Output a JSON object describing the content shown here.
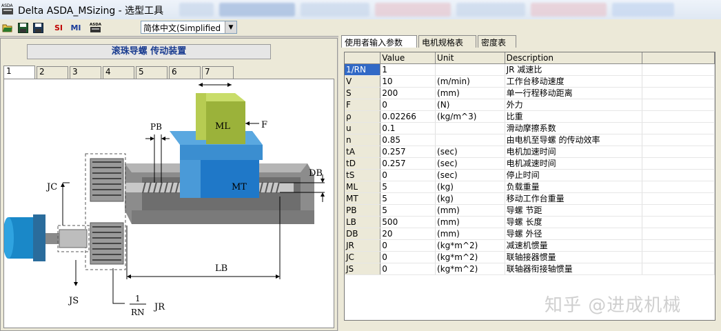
{
  "window": {
    "title": "Delta ASDA_MSizing - 选型工具"
  },
  "toolbar": {
    "si_label": "SI",
    "mi_label": "MI",
    "language_value": "简体中文(Simplified"
  },
  "left": {
    "header": "滚珠导螺 传动装置",
    "tabs": [
      "1",
      "2",
      "3",
      "4",
      "5",
      "6",
      "7"
    ],
    "diagram_labels": {
      "ml": "ML",
      "mt": "MT",
      "f": "F",
      "pb": "PB",
      "db": "DB",
      "jc": "JC",
      "js": "JS",
      "lb": "LB",
      "one": "1",
      "rn": "RN",
      "jr": "JR"
    }
  },
  "right": {
    "tabs": [
      "使用者输入参数",
      "电机规格表",
      "密度表"
    ],
    "columns": [
      "",
      "Value",
      "Unit",
      "Description",
      ""
    ],
    "rows": [
      {
        "name": "1/RN",
        "value": "1",
        "unit": "",
        "desc": "JR 减速比"
      },
      {
        "name": "V",
        "value": "10",
        "unit": "(m/min)",
        "desc": "工作台移动速度"
      },
      {
        "name": "S",
        "value": "200",
        "unit": "(mm)",
        "desc": "单一行程移动距离"
      },
      {
        "name": "F",
        "value": "0",
        "unit": "(N)",
        "desc": "外力"
      },
      {
        "name": "ρ",
        "value": "0.02266",
        "unit": "(kg/m^3)",
        "desc": "比重"
      },
      {
        "name": "u",
        "value": "0.1",
        "unit": "",
        "desc": "滑动摩擦系数"
      },
      {
        "name": "n",
        "value": "0.85",
        "unit": "",
        "desc": "由电机至导螺 的传动效率"
      },
      {
        "name": "tA",
        "value": "0.257",
        "unit": "(sec)",
        "desc": "电机加速时间"
      },
      {
        "name": "tD",
        "value": "0.257",
        "unit": "(sec)",
        "desc": "电机减速时间"
      },
      {
        "name": "tS",
        "value": "0",
        "unit": "(sec)",
        "desc": "停止时间"
      },
      {
        "name": "ML",
        "value": "5",
        "unit": "(kg)",
        "desc": "负载重量"
      },
      {
        "name": "MT",
        "value": "5",
        "unit": "(kg)",
        "desc": "移动工作台重量"
      },
      {
        "name": "PB",
        "value": "5",
        "unit": "(mm)",
        "desc": "导螺 节距"
      },
      {
        "name": "LB",
        "value": "500",
        "unit": "(mm)",
        "desc": "导螺 长度"
      },
      {
        "name": "DB",
        "value": "20",
        "unit": "(mm)",
        "desc": "导螺 外径"
      },
      {
        "name": "JR",
        "value": "0",
        "unit": "(kg*m^2)",
        "desc": "减速机惯量"
      },
      {
        "name": "JC",
        "value": "0",
        "unit": "(kg*m^2)",
        "desc": "联轴接器惯量"
      },
      {
        "name": "JS",
        "value": "0",
        "unit": "(kg*m^2)",
        "desc": "联轴器衔接轴惯量"
      }
    ]
  },
  "watermark": "知乎 @进成机械"
}
